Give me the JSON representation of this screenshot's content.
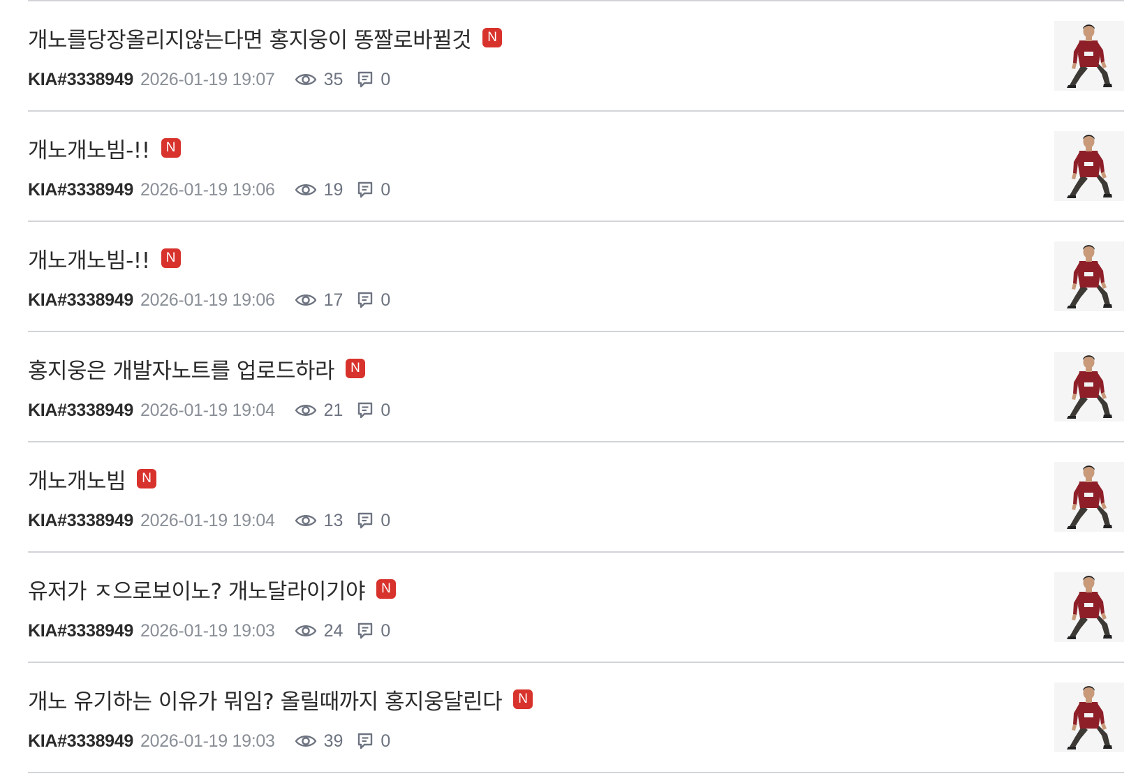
{
  "posts": [
    {
      "title": "개노를당장올리지않는다면 홍지웅이 똥짤로바뀔것",
      "badge": "N",
      "author": "KIA#3338949",
      "datetime": "2026-01-19 19:07",
      "views": "35",
      "comments": "0"
    },
    {
      "title": "개노개노빔-!!",
      "badge": "N",
      "author": "KIA#3338949",
      "datetime": "2026-01-19 19:06",
      "views": "19",
      "comments": "0"
    },
    {
      "title": "개노개노빔-!!",
      "badge": "N",
      "author": "KIA#3338949",
      "datetime": "2026-01-19 19:06",
      "views": "17",
      "comments": "0"
    },
    {
      "title": "홍지웅은 개발자노트를 업로드하라",
      "badge": "N",
      "author": "KIA#3338949",
      "datetime": "2026-01-19 19:04",
      "views": "21",
      "comments": "0"
    },
    {
      "title": "개노개노빔",
      "badge": "N",
      "author": "KIA#3338949",
      "datetime": "2026-01-19 19:04",
      "views": "13",
      "comments": "0"
    },
    {
      "title": "유저가 ㅈ으로보이노? 개노달라이기야",
      "badge": "N",
      "author": "KIA#3338949",
      "datetime": "2026-01-19 19:03",
      "views": "24",
      "comments": "0"
    },
    {
      "title": "개노 유기하는 이유가 뭐임? 올릴때까지 홍지웅달린다",
      "badge": "N",
      "author": "KIA#3338949",
      "datetime": "2026-01-19 19:03",
      "views": "39",
      "comments": "0"
    }
  ],
  "icons": {
    "views": "eye-icon",
    "comments": "comment-icon"
  },
  "colors": {
    "badge": "#d8322c",
    "divider": "#d2d4d8",
    "title": "#2b2b2b",
    "meta": "#8a8f97"
  }
}
